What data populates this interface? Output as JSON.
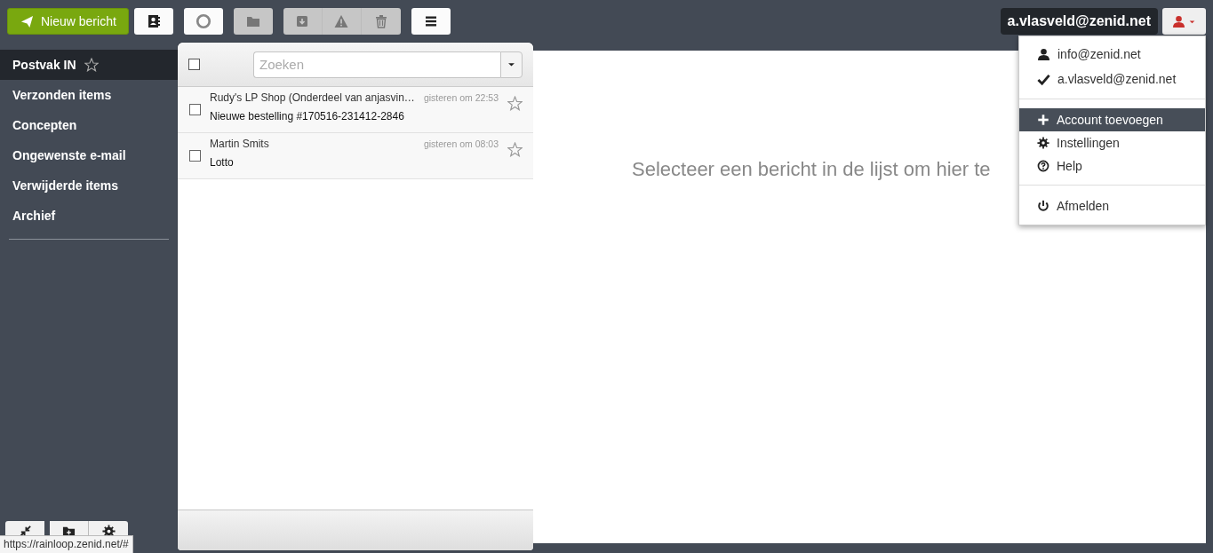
{
  "toolbar": {
    "compose_button": "Nieuw bericht",
    "button_groups": [
      [
        {
          "kind": "contacts",
          "disabled": false
        }
      ],
      [
        {
          "kind": "refresh",
          "disabled": false
        }
      ],
      [
        {
          "kind": "move",
          "disabled": true
        }
      ],
      [
        {
          "kind": "archive",
          "disabled": true
        },
        {
          "kind": "spam",
          "disabled": true
        },
        {
          "kind": "delete",
          "disabled": true
        }
      ],
      [
        {
          "kind": "more",
          "disabled": false
        }
      ]
    ],
    "account_label": "a.vlasveld@zenid.net"
  },
  "sidebar": {
    "items": [
      {
        "label": "Postvak IN",
        "selected": true
      },
      {
        "label": "Verzonden items",
        "selected": false
      },
      {
        "label": "Concepten",
        "selected": false
      },
      {
        "label": "Ongewenste e-mail",
        "selected": false
      },
      {
        "label": "Verwijderde items",
        "selected": false
      },
      {
        "label": "Archief",
        "selected": false
      }
    ],
    "bottom_buttons": [
      {
        "kind": "collapse"
      },
      {
        "kind": "new-folder"
      },
      {
        "kind": "settings"
      }
    ]
  },
  "message_list": {
    "select_all_checked": false,
    "search": {
      "placeholder": "Zoeken"
    },
    "messages": [
      {
        "sender": "Rudy's LP Shop (Onderdeel van anjasvin…",
        "time": "gisteren om 22:53",
        "subject": "Nieuwe bestelling #170516-231412-2846",
        "checked": false,
        "starred": false
      },
      {
        "sender": "Martin Smits",
        "time": "gisteren om 08:03",
        "subject": "Lotto",
        "checked": false,
        "starred": false
      }
    ]
  },
  "preview": {
    "message": "Selecteer een bericht in de lijst om hier te"
  },
  "account_menu": {
    "accounts": [
      {
        "email": "info@zenid.net",
        "current": false
      },
      {
        "email": "a.vlasveld@zenid.net",
        "current": true
      }
    ],
    "action_sections": [
      [
        {
          "kind": "add",
          "label": "Account toevoegen",
          "selected": true
        },
        {
          "kind": "settings",
          "label": "Instellingen",
          "selected": false
        },
        {
          "kind": "help",
          "label": "Help",
          "selected": false
        }
      ],
      [
        {
          "kind": "logout",
          "label": "Afmelden",
          "selected": false
        }
      ]
    ]
  },
  "status_url": "https://rainloop.zenid.net/#"
}
